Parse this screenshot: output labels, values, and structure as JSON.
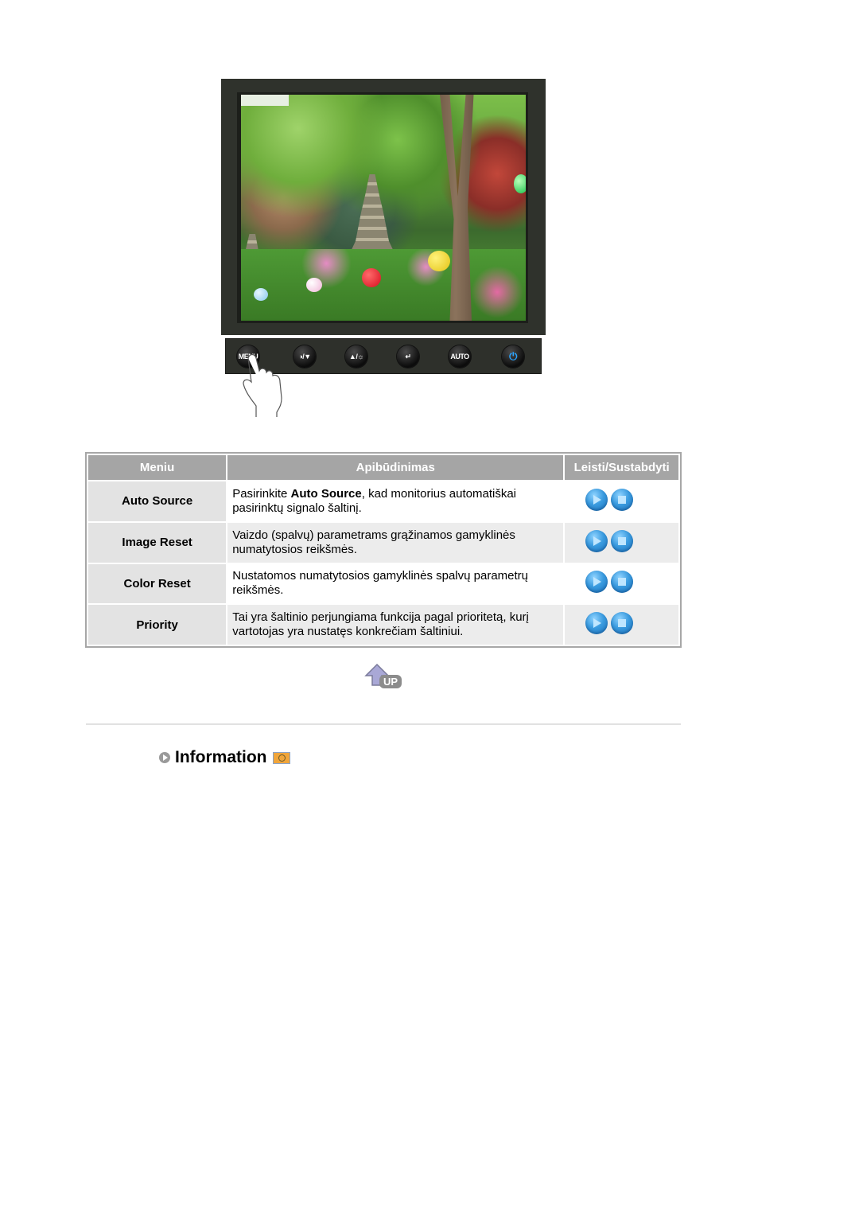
{
  "monitor": {
    "buttons": [
      {
        "id": "menu",
        "label": "MENU",
        "icon": "menu-icon"
      },
      {
        "id": "magicbright",
        "label": "◑/▼",
        "icon": "magicbright-down-icon"
      },
      {
        "id": "brightness",
        "label": "▲/☼",
        "icon": "brightness-up-icon"
      },
      {
        "id": "enter",
        "label": "↵",
        "icon": "enter-icon"
      },
      {
        "id": "auto",
        "label": "AUTO",
        "icon": "auto-icon"
      },
      {
        "id": "power",
        "label": "⏻",
        "icon": "power-icon"
      }
    ],
    "pressed_button": "menu"
  },
  "table": {
    "headers": {
      "menu": "Meniu",
      "description": "Apibūdinimas",
      "controls": "Leisti/Sustabdyti"
    },
    "rows": [
      {
        "name": "Auto Source",
        "desc_prefix": "Pasirinkite ",
        "desc_bold": "Auto Source",
        "desc_suffix": ", kad monitorius automatiškai pasirinktų signalo šaltinį.",
        "play_icon": "play-icon",
        "stop_icon": "stop-icon"
      },
      {
        "name": "Image Reset",
        "desc_prefix": "Vaizdo (spalvų) parametrams grąžinamos gamyklinės numatytosios reikšmės.",
        "desc_bold": "",
        "desc_suffix": "",
        "play_icon": "play-icon",
        "stop_icon": "stop-icon"
      },
      {
        "name": "Color Reset",
        "desc_prefix": "Nustatomos numatytosios gamyklinės spalvų parametrų reikšmės.",
        "desc_bold": "",
        "desc_suffix": "",
        "play_icon": "play-icon",
        "stop_icon": "stop-icon"
      },
      {
        "name": "Priority",
        "desc_prefix": "Tai yra šaltinio perjungiama funkcija pagal prioritetą, kurį vartotojas yra nustatęs konkrečiam šaltiniui.",
        "desc_bold": "",
        "desc_suffix": "",
        "play_icon": "play-icon",
        "stop_icon": "stop-icon"
      }
    ]
  },
  "up_link": {
    "label": "UP",
    "icon": "up-arrow-icon"
  },
  "section": {
    "title": "Information",
    "bullet_icon": "arrow-bullet-icon",
    "badge_icon": "clock-badge-icon"
  },
  "colors": {
    "header_bg": "#a5a5a5",
    "name_cell_bg": "#e3e3e3",
    "row_alt_bg": "#ececec",
    "button_blue": "#3a9bdf",
    "bezel": "#2f322c",
    "power_blue": "#2aa4ff"
  }
}
